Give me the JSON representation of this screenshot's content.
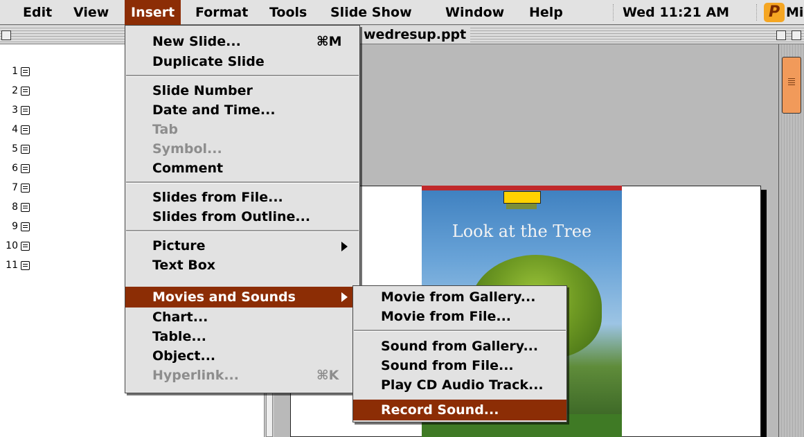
{
  "menubar": {
    "items": [
      {
        "label": "Edit"
      },
      {
        "label": "View"
      },
      {
        "label": "Insert"
      },
      {
        "label": "Format"
      },
      {
        "label": "Tools"
      },
      {
        "label": "Slide Show"
      },
      {
        "label": "Window"
      },
      {
        "label": "Help"
      }
    ],
    "clock": "Wed 11:21 AM",
    "app_icon_glyph": "P",
    "app_name": "Microsoft PowerPoint"
  },
  "window": {
    "title": "wedresup.ppt"
  },
  "outline": {
    "slides": [
      "1",
      "2",
      "3",
      "4",
      "5",
      "6",
      "7",
      "8",
      "9",
      "10",
      "11"
    ]
  },
  "slide": {
    "book_title": "Look at the Tree"
  },
  "insert_menu": {
    "new_slide": {
      "label": "New Slide...",
      "shortcut": "⌘M"
    },
    "duplicate_slide": {
      "label": "Duplicate Slide"
    },
    "slide_number": {
      "label": "Slide Number"
    },
    "date_and_time": {
      "label": "Date and Time..."
    },
    "tab": {
      "label": "Tab"
    },
    "symbol": {
      "label": "Symbol..."
    },
    "comment": {
      "label": "Comment"
    },
    "slides_from_file": {
      "label": "Slides from File..."
    },
    "slides_from_outline": {
      "label": "Slides from Outline..."
    },
    "picture": {
      "label": "Picture"
    },
    "text_box": {
      "label": "Text Box"
    },
    "movies_and_sounds": {
      "label": "Movies and Sounds"
    },
    "chart": {
      "label": "Chart..."
    },
    "table": {
      "label": "Table..."
    },
    "object": {
      "label": "Object..."
    },
    "hyperlink": {
      "label": "Hyperlink...",
      "shortcut": "⌘K"
    }
  },
  "movies_sounds_submenu": {
    "movie_from_gallery": "Movie from Gallery...",
    "movie_from_file": "Movie from File...",
    "sound_from_gallery": "Sound from Gallery...",
    "sound_from_file": "Sound from File...",
    "play_cd_audio": "Play CD Audio Track...",
    "record_sound": "Record Sound..."
  },
  "colors": {
    "highlight": "#8c2d05",
    "menu_bg": "#e2e2e2",
    "disabled_text": "#8d8d8d",
    "scroll_thumb": "#f19a5a"
  }
}
